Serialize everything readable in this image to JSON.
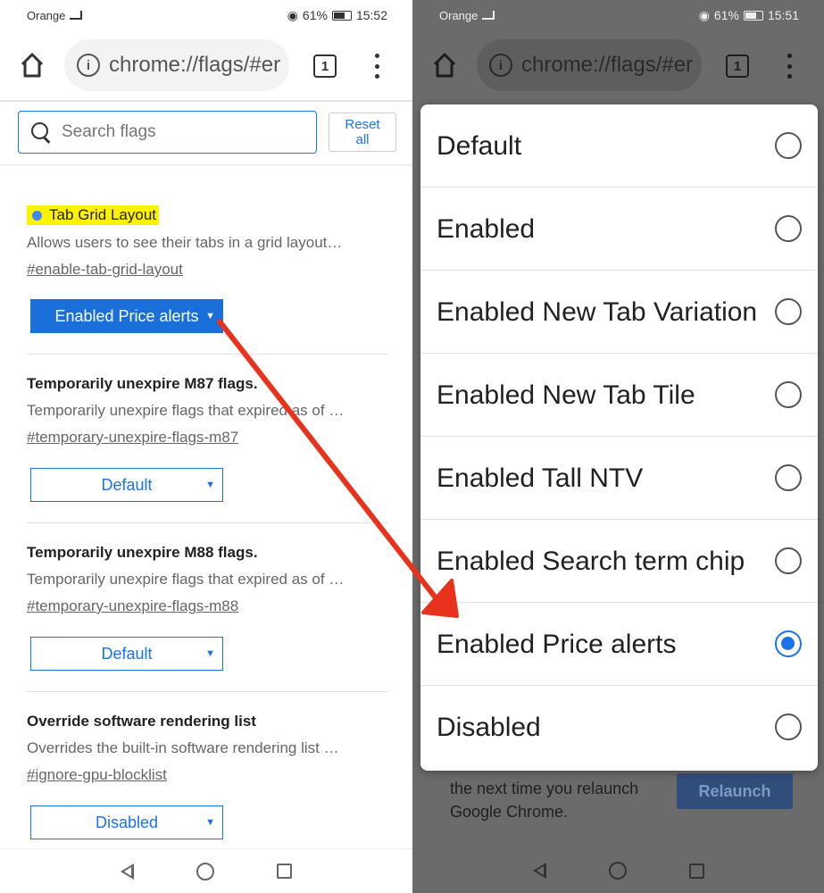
{
  "left": {
    "status": {
      "carrier": "Orange",
      "battery": "61%",
      "time": "15:52"
    },
    "toolbar": {
      "url": "chrome://flags/#er",
      "tab_count": "1"
    },
    "search": {
      "placeholder": "Search flags",
      "reset_label_line1": "Reset",
      "reset_label_line2": "all"
    },
    "flags": [
      {
        "title": "Tab Grid Layout",
        "desc": "Allows users to see their tabs in a grid layout…",
        "link": "#enable-tab-grid-layout",
        "value": "Enabled Price alerts"
      },
      {
        "title": "Temporarily unexpire M87 flags.",
        "desc": "Temporarily unexpire flags that expired as of …",
        "link": "#temporary-unexpire-flags-m87",
        "value": "Default"
      },
      {
        "title": "Temporarily unexpire M88 flags.",
        "desc": "Temporarily unexpire flags that expired as of …",
        "link": "#temporary-unexpire-flags-m88",
        "value": "Default"
      },
      {
        "title": "Override software rendering list",
        "desc": "Overrides the built-in software rendering list …",
        "link": "#ignore-gpu-blocklist",
        "value": "Disabled"
      }
    ]
  },
  "right": {
    "status": {
      "carrier": "Orange",
      "battery": "61%",
      "time": "15:51"
    },
    "toolbar": {
      "url": "chrome://flags/#er",
      "tab_count": "1"
    },
    "options": [
      {
        "label": "Default",
        "selected": false
      },
      {
        "label": "Enabled",
        "selected": false
      },
      {
        "label": "Enabled New Tab Variation",
        "selected": false
      },
      {
        "label": "Enabled New Tab Tile",
        "selected": false
      },
      {
        "label": "Enabled Tall NTV",
        "selected": false
      },
      {
        "label": "Enabled Search term chip",
        "selected": false
      },
      {
        "label": "Enabled Price alerts",
        "selected": true
      },
      {
        "label": "Disabled",
        "selected": false
      }
    ],
    "behind_text": "the next time you relaunch Google Chrome.",
    "relaunch_label": "Relaunch"
  },
  "colors": {
    "accent": "#1a73e8",
    "highlight": "#fff200",
    "arrow": "#e8321c"
  },
  "icons": [
    "home-icon",
    "info-icon",
    "tab-switcher-icon",
    "overflow-menu-icon",
    "search-icon",
    "radio-icon",
    "back-nav-icon",
    "home-nav-icon",
    "recents-nav-icon",
    "arrow-annotation"
  ]
}
